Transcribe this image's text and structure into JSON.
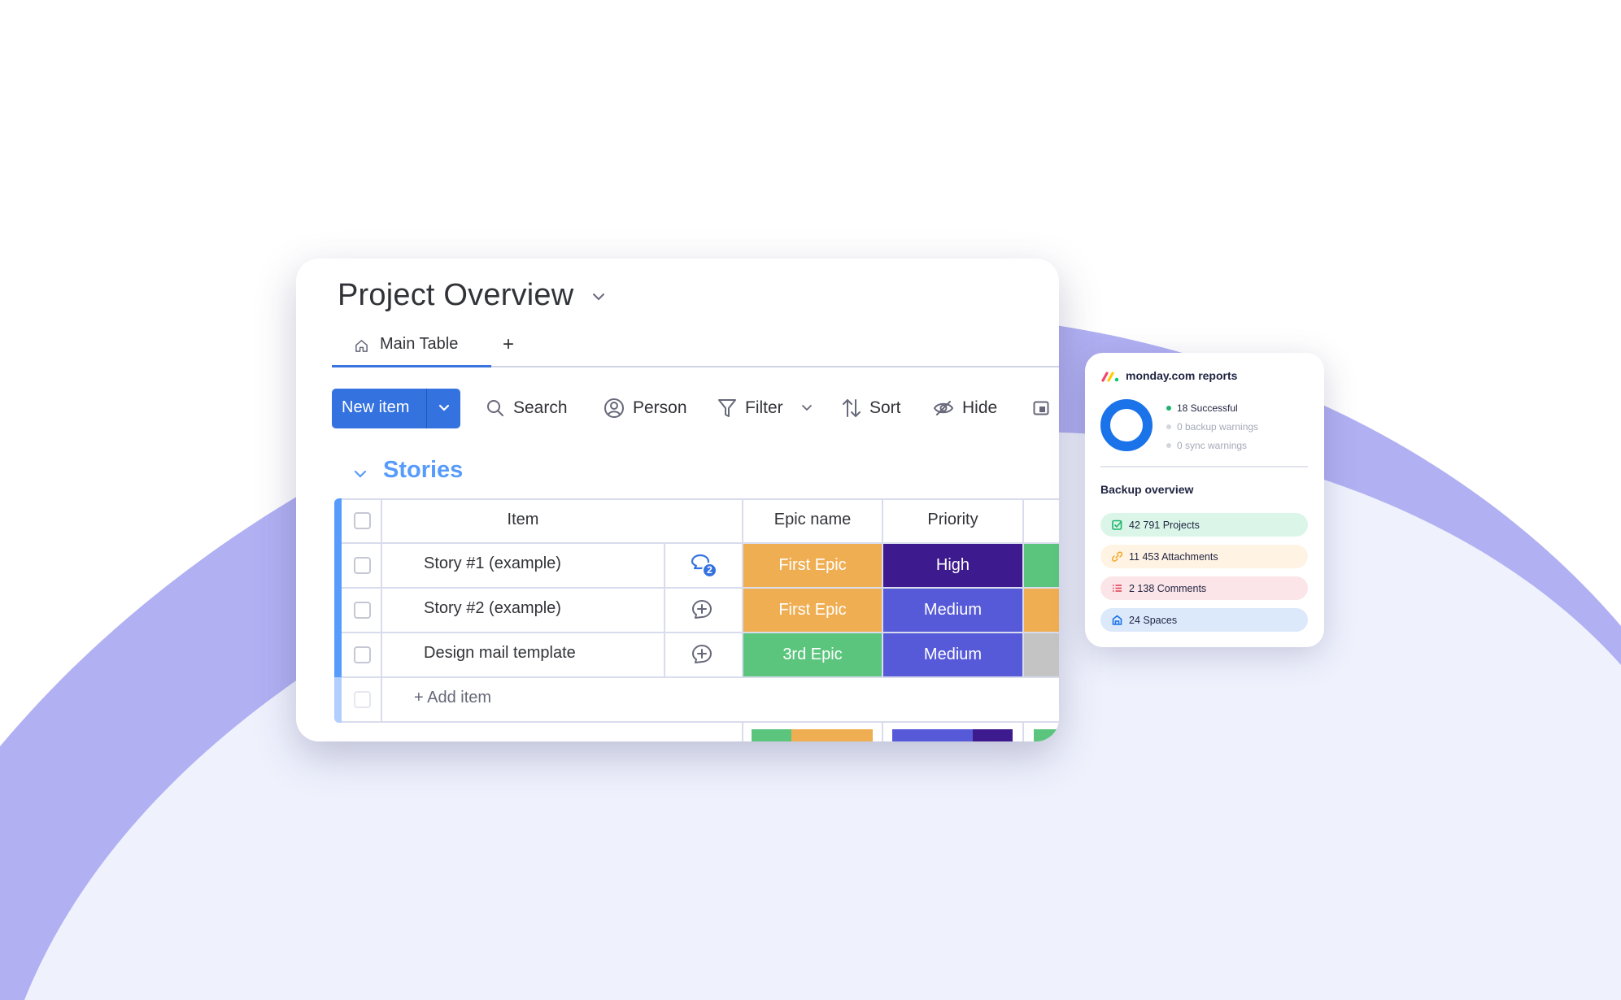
{
  "colors": {
    "brand_blue": "#3472e0",
    "group_blue": "#579bfc",
    "orange": "#f0ae52",
    "green": "#5bc57d",
    "dark_purple": "#3e1a8f",
    "medium_purple": "#575ad8",
    "grey": "#c4c4c4",
    "arc_purple": "#b1b0f3",
    "bg_lavender": "#eff2fd"
  },
  "board": {
    "title": "Project Overview",
    "tabs": [
      {
        "label": "Main Table",
        "icon": "home-icon",
        "active": true
      }
    ],
    "add_tab_label": "+",
    "toolbar": {
      "new_item_label": "New item",
      "search_label": "Search",
      "person_label": "Person",
      "filter_label": "Filter",
      "sort_label": "Sort",
      "hide_label": "Hide"
    },
    "group": {
      "title": "Stories",
      "columns": {
        "item": "Item",
        "epic": "Epic name",
        "priority": "Priority"
      },
      "rows": [
        {
          "name": "Story #1 (example)",
          "comments": "2",
          "epic": "First Epic",
          "epic_color": "#f0ae52",
          "priority": "High",
          "priority_color": "#3e1a8f",
          "status_color": "#5bc57d"
        },
        {
          "name": "Story #2 (example)",
          "comments": "",
          "epic": "First Epic",
          "epic_color": "#f0ae52",
          "priority": "Medium",
          "priority_color": "#575ad8",
          "status_color": "#f0ae52"
        },
        {
          "name": "Design mail template",
          "comments": "",
          "epic": "3rd Epic",
          "epic_color": "#5bc57d",
          "priority": "Medium",
          "priority_color": "#575ad8",
          "status_color": "#c4c4c4"
        }
      ],
      "add_item_label": "+ Add item",
      "summary": {
        "epic": [
          {
            "color": "#5bc57d",
            "fraction": 0.33
          },
          {
            "color": "#f0ae52",
            "fraction": 0.67
          }
        ],
        "priority": [
          {
            "color": "#575ad8",
            "fraction": 0.67
          },
          {
            "color": "#3e1a8f",
            "fraction": 0.33
          }
        ]
      }
    }
  },
  "reports": {
    "title": "monday.com reports",
    "donut": {
      "successful": 18,
      "backup_warnings": 0,
      "sync_warnings": 0,
      "color": "#1a73e8"
    },
    "legend": [
      {
        "label": "18 Successful",
        "dot": "#1db46c",
        "text_color": "#1f2440"
      },
      {
        "label": "0 backup warnings",
        "dot": "#d4d6de",
        "text_color": "#a5a9b8"
      },
      {
        "label": "0 sync warnings",
        "dot": "#d4d6de",
        "text_color": "#a5a9b8"
      }
    ],
    "section_title": "Backup overview",
    "stats": [
      {
        "label": "42 791 Projects",
        "icon": "checkbox-icon",
        "bg": "#dbf6e8",
        "icon_color": "#1db46c"
      },
      {
        "label": "11 453 Attachments",
        "icon": "link-icon",
        "bg": "#fff3e4",
        "icon_color": "#f5a623"
      },
      {
        "label": "2 138 Comments",
        "icon": "list-icon",
        "bg": "#fbe5e8",
        "icon_color": "#e03a4e"
      },
      {
        "label": "24 Spaces",
        "icon": "home-icon",
        "bg": "#dbe9fb",
        "icon_color": "#1a73e8"
      }
    ]
  }
}
